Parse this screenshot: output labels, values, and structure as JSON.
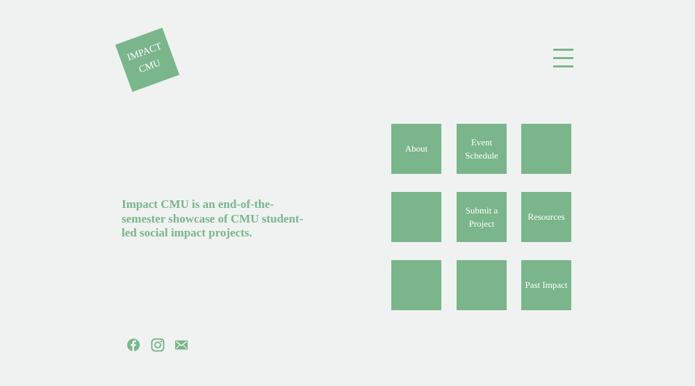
{
  "logo": {
    "line1": "IMPACT",
    "line2": "CMU"
  },
  "menu": {
    "icon": "hamburger-menu-icon"
  },
  "tagline": "Impact CMU is an end-of-the-semester showcase of CMU student-led social impact projects.",
  "grid": {
    "tiles": [
      {
        "label": "About"
      },
      {
        "label": "Event Schedule"
      },
      {
        "label": ""
      },
      {
        "label": ""
      },
      {
        "label": "Submit a Project"
      },
      {
        "label": "Resources"
      },
      {
        "label": ""
      },
      {
        "label": ""
      },
      {
        "label": "Past Impact"
      }
    ]
  },
  "social": {
    "items": [
      {
        "icon": "facebook-icon"
      },
      {
        "icon": "instagram-icon"
      },
      {
        "icon": "email-icon"
      }
    ]
  },
  "colors": {
    "accent": "#7ab58b",
    "background": "#f0f2f1",
    "tile_text": "#ffffff"
  }
}
